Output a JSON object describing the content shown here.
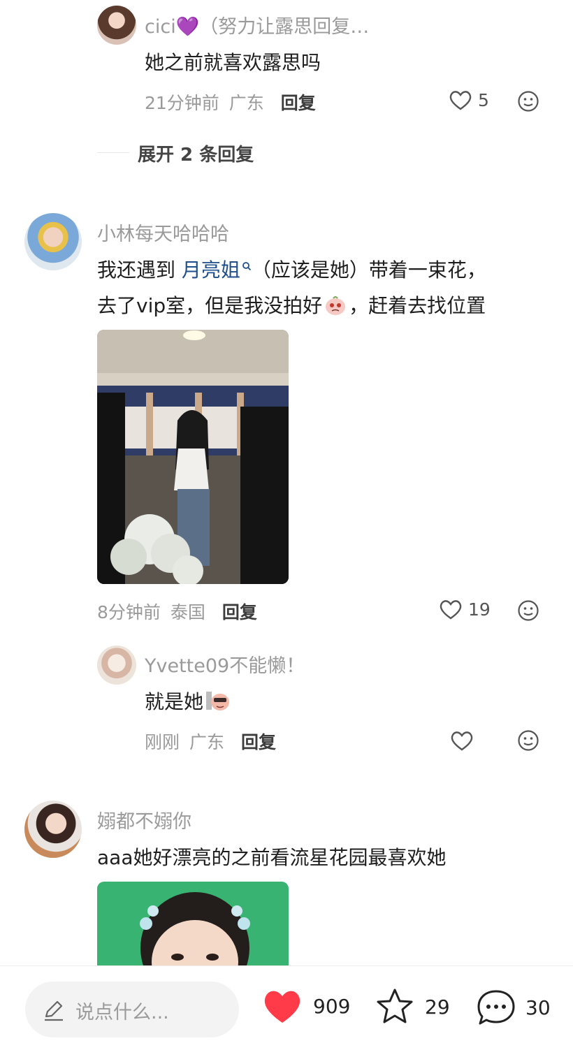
{
  "comments": {
    "c1": {
      "name": "cici💜（努力让露思回复…",
      "text": "她之前就喜欢露思吗",
      "time": "21分钟前",
      "location": "广东",
      "reply": "回复",
      "likes": "5"
    },
    "expand": "展开 2 条回复",
    "c2": {
      "name": "小林每天哈哈哈",
      "line1_before": "我还遇到 ",
      "mention": "月亮姐",
      "line1_after": "（应该是她）带着一束花，",
      "line2_before": "去了vip室，但是我没拍好",
      "line2_after": "，赶着去找位置",
      "time": "8分钟前",
      "location": "泰国",
      "reply": "回复",
      "likes": "19"
    },
    "c2_reply": {
      "name": "Yvette09不能懒！",
      "text": "就是她",
      "time": "刚刚",
      "location": "广东",
      "reply": "回复"
    },
    "c3": {
      "name": "嫋都不嫋你",
      "text": "aaa她好漂亮的之前看流星花园最喜欢她"
    }
  },
  "bottom_bar": {
    "input_placeholder": "说点什么...",
    "likes": "909",
    "favorites": "29",
    "comments": "30"
  },
  "icons": {
    "like": "heart-outline-icon",
    "emoji": "emoji-face-icon",
    "edit": "pencil-icon",
    "favorite": "star-outline-icon",
    "comment": "chat-bubble-icon",
    "search": "search-icon"
  },
  "colors": {
    "accent_heart": "#ff3b4a",
    "mention": "#1f4f8a",
    "meta": "#9a9a9a"
  }
}
